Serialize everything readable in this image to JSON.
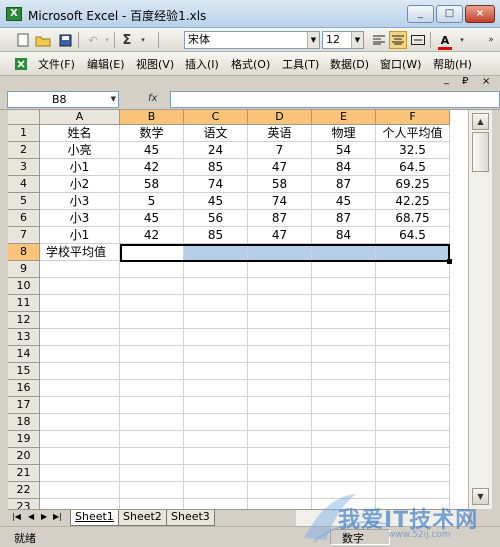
{
  "window": {
    "title": "Microsoft Excel - 百度经验1.xls",
    "app_icon_glyph": "X",
    "controls": [
      "_",
      "□",
      "×"
    ]
  },
  "toolbar": {
    "font_name": "宋体",
    "font_size": "12",
    "sum_glyph": "Σ"
  },
  "menu": {
    "items": [
      "文件(F)",
      "编辑(E)",
      "视图(V)",
      "插入(I)",
      "格式(O)",
      "工具(T)",
      "数据(D)",
      "窗口(W)",
      "帮助(H)"
    ],
    "mdi": [
      "_",
      "₽",
      "×"
    ]
  },
  "formula_bar": {
    "name_box": "B8",
    "fx": "fx",
    "value": ""
  },
  "columns": [
    "A",
    "B",
    "C",
    "D",
    "E",
    "F"
  ],
  "rows": [
    "1",
    "2",
    "3",
    "4",
    "5",
    "6",
    "7",
    "8",
    "9",
    "10",
    "11",
    "12",
    "13",
    "14",
    "15",
    "16",
    "17",
    "18",
    "19",
    "20",
    "21",
    "22",
    "23"
  ],
  "table": {
    "header": [
      "姓名",
      "数学",
      "语文",
      "英语",
      "物理",
      "个人平均值"
    ],
    "rows": [
      [
        "小亮",
        "45",
        "24",
        "7",
        "54",
        "32.5"
      ],
      [
        "小1",
        "42",
        "85",
        "47",
        "84",
        "64.5"
      ],
      [
        "小2",
        "58",
        "74",
        "58",
        "87",
        "69.25"
      ],
      [
        "小3",
        "5",
        "45",
        "74",
        "45",
        "42.25"
      ],
      [
        "小3",
        "45",
        "56",
        "87",
        "87",
        "68.75"
      ],
      [
        "小1",
        "42",
        "85",
        "47",
        "84",
        "64.5"
      ]
    ],
    "footer_label": "学校平均值"
  },
  "sheets": [
    "Sheet1",
    "Sheet2",
    "Sheet3"
  ],
  "active_sheet": "Sheet1",
  "status": {
    "left": "就绪",
    "right": "数字"
  },
  "watermark": {
    "text": "我爱IT技术网",
    "url": "www.52ij.com"
  },
  "colors": {
    "selection_header": "#f9c47a",
    "selection_fill": "#b6cfe8"
  }
}
